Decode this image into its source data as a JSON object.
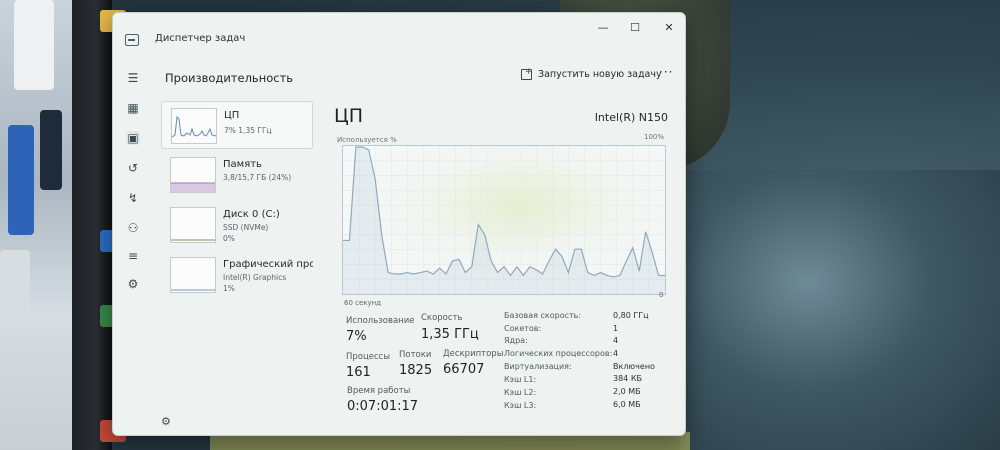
{
  "window": {
    "title": "Диспетчер задач",
    "controls": {
      "minimize": "—",
      "maximize": "☐",
      "close": "✕"
    }
  },
  "header": {
    "page_title": "Производительность",
    "run_new_task": "Запустить новую задачу",
    "more": "···"
  },
  "nav": {
    "icons": [
      "menu-icon",
      "processes-icon",
      "performance-icon",
      "app-history-icon",
      "startup-apps-icon",
      "users-icon",
      "details-icon",
      "services-icon",
      "settings-icon"
    ]
  },
  "resources": [
    {
      "name": "ЦП",
      "sub": "7% 1,35 ГГц"
    },
    {
      "name": "Память",
      "sub": "3,8/15,7 ГБ (24%)"
    },
    {
      "name": "Диск 0 (C:)",
      "sub": "SSD (NVMe)",
      "sub2": "0%"
    },
    {
      "name": "Графический про",
      "sub": "Intel(R) Graphics",
      "sub2": "1%"
    }
  ],
  "cpu": {
    "title": "ЦП",
    "model": "Intel(R) N150",
    "util_label": "Используется %",
    "util_max": "100%",
    "time_label": "60 секунд",
    "zero_label": "0",
    "stats": {
      "usage_label": "Использование",
      "usage": "7%",
      "speed_label": "Скорость",
      "speed": "1,35 ГГц",
      "processes_label": "Процессы",
      "processes": "161",
      "threads_label": "Потоки",
      "threads": "1825",
      "handles_label": "Дескрипторы",
      "handles": "66707",
      "uptime_label": "Время работы",
      "uptime": "0:07:01:17"
    },
    "specs": [
      {
        "label": "Базовая скорость:",
        "value": "0,80 ГГц"
      },
      {
        "label": "Сокетов:",
        "value": "1"
      },
      {
        "label": "Ядра:",
        "value": "4"
      },
      {
        "label": "Логических процессоров:",
        "value": "4"
      },
      {
        "label": "Виртуализация:",
        "value": "Включено"
      },
      {
        "label": "Кэш L1:",
        "value": "384 КБ"
      },
      {
        "label": "Кэш L2:",
        "value": "2,0 МБ"
      },
      {
        "label": "Кэш L3:",
        "value": "6,0 МБ"
      }
    ]
  },
  "chart_data": {
    "type": "area",
    "title": "",
    "ylabel": "Используется %",
    "xlabel": "60 секунд",
    "ylim": [
      0,
      100
    ],
    "series": [
      {
        "values": [
          36,
          36,
          100,
          100,
          98,
          78,
          40,
          14,
          13,
          13,
          14,
          13,
          14,
          15,
          13,
          17,
          13,
          22,
          23,
          14,
          18,
          47,
          40,
          22,
          14,
          18,
          12,
          18,
          12,
          18,
          16,
          13,
          22,
          30,
          25,
          14,
          30,
          30,
          14,
          12,
          14,
          12,
          11,
          12,
          22,
          31,
          15,
          42,
          28,
          12,
          12
        ]
      }
    ]
  }
}
